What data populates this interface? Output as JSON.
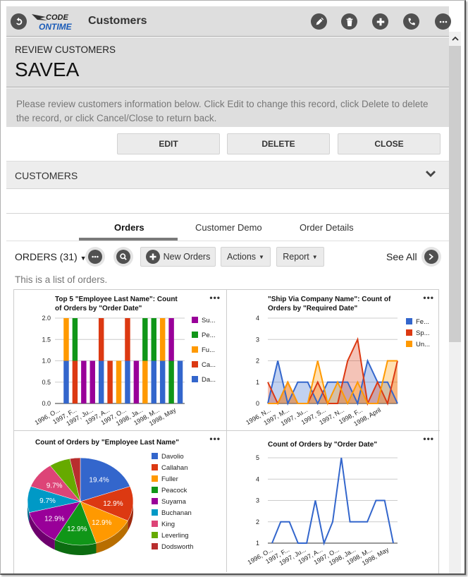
{
  "appbar": {
    "title": "Customers",
    "logo_line1": "CODE",
    "logo_line2": "ONTIME",
    "icons": [
      "back-icon",
      "pencil-icon",
      "trash-icon",
      "plus-icon",
      "phone-icon",
      "more-icon"
    ]
  },
  "review": {
    "subtitle": "REVIEW CUSTOMERS",
    "record": "SAVEA",
    "description": "Please review customers information below. Click Edit to change this record, click Delete to delete the record, or click Cancel/Close to return back."
  },
  "actions": {
    "edit": "EDIT",
    "delete": "DELETE",
    "close": "CLOSE"
  },
  "section": {
    "label": "CUSTOMERS"
  },
  "tabs": [
    {
      "label": "Orders",
      "active": true
    },
    {
      "label": "Customer Demo",
      "active": false
    },
    {
      "label": "Order Details",
      "active": false
    }
  ],
  "orders_toolbar": {
    "label": "ORDERS (31)",
    "new_button": "New Orders",
    "actions_button": "Actions",
    "report_button": "Report",
    "see_all": "See All",
    "description": "This is a list of orders."
  },
  "more_label": "•••",
  "colors": {
    "blue": "#3366cc",
    "red": "#dc3912",
    "orange": "#ff9900",
    "green": "#109618",
    "purple": "#990099",
    "teal": "#0099c6",
    "pink": "#dd4477",
    "lime": "#66aa00",
    "darkred": "#b82e2e"
  },
  "chart_data": [
    {
      "type": "bar",
      "stacked": true,
      "title_lines": [
        "Top 5 \"Employee Last Name\": Count",
        "of Orders by \"Order Date\""
      ],
      "xlabel": "",
      "ylabel": "",
      "ylim": [
        0,
        2
      ],
      "yticks": [
        "0.0",
        "0.5",
        "1.0",
        "1.5",
        "2.0"
      ],
      "xtick_labels": [
        "1996, O...",
        "1997, F...",
        "1997, Ju...",
        "1997, A...",
        "1997, O...",
        "1998, Ja...",
        "1998, M...",
        "1998, May"
      ],
      "legend_position": "right",
      "series": [
        {
          "name": "Da...",
          "color": "#3366cc",
          "values": [
            1,
            0,
            0,
            0,
            1,
            0,
            0,
            1,
            0,
            0,
            1,
            1,
            0,
            1
          ]
        },
        {
          "name": "Ca...",
          "color": "#dc3912",
          "values": [
            0,
            1,
            0,
            0,
            1,
            1,
            0,
            1,
            0,
            0,
            0,
            0,
            0,
            0
          ]
        },
        {
          "name": "Fu...",
          "color": "#ff9900",
          "values": [
            1,
            0,
            0,
            0,
            0,
            0,
            1,
            0,
            0,
            1,
            0,
            1,
            0,
            0
          ]
        },
        {
          "name": "Pe...",
          "color": "#109618",
          "values": [
            0,
            1,
            0,
            0,
            0,
            0,
            0,
            0,
            0,
            1,
            1,
            0,
            1,
            0
          ]
        },
        {
          "name": "Su...",
          "color": "#990099",
          "values": [
            0,
            0,
            1,
            1,
            0,
            0,
            0,
            0,
            1,
            0,
            0,
            0,
            1,
            0
          ]
        }
      ],
      "legend_order": [
        "Su...",
        "Pe...",
        "Fu...",
        "Ca...",
        "Da..."
      ]
    },
    {
      "type": "area",
      "title_lines": [
        "\"Ship Via Company Name\": Count of",
        "Orders by \"Required Date\""
      ],
      "ylim": [
        0,
        4
      ],
      "yticks": [
        "0",
        "1",
        "2",
        "3",
        "4"
      ],
      "xtick_labels": [
        "1996, N...",
        "1997, M...",
        "1997, Ju...",
        "1997, S...",
        "1997, N...",
        "1998, F...",
        "1998, April"
      ],
      "legend_position": "right",
      "series": [
        {
          "name": "Fe...",
          "color": "#3366cc",
          "values": [
            0,
            2,
            0,
            1,
            1,
            0,
            1,
            1,
            1,
            0,
            2,
            1,
            1,
            0
          ]
        },
        {
          "name": "Sp...",
          "color": "#dc3912",
          "values": [
            1,
            0,
            1,
            0,
            0,
            1,
            0,
            0,
            2,
            3,
            0,
            1,
            0,
            2
          ]
        },
        {
          "name": "Un...",
          "color": "#ff9900",
          "values": [
            0,
            0,
            1,
            0,
            0,
            2,
            0,
            1,
            0,
            1,
            0,
            0,
            2,
            2
          ]
        }
      ]
    },
    {
      "type": "pie",
      "title": "Count of Orders by \"Employee Last Name\"",
      "legend_position": "right",
      "slices": [
        {
          "label": "Davolio",
          "percent": 19.4,
          "color": "#3366cc"
        },
        {
          "label": "Callahan",
          "percent": 12.9,
          "color": "#dc3912"
        },
        {
          "label": "Fuller",
          "percent": 12.9,
          "color": "#ff9900"
        },
        {
          "label": "Peacock",
          "percent": 12.9,
          "color": "#109618"
        },
        {
          "label": "Suyama",
          "percent": 12.9,
          "color": "#990099"
        },
        {
          "label": "Buchanan",
          "percent": 9.7,
          "color": "#0099c6"
        },
        {
          "label": "King",
          "percent": 9.7,
          "color": "#dd4477"
        },
        {
          "label": "Leverling",
          "percent": 6.5,
          "color": "#66aa00"
        },
        {
          "label": "Dodsworth",
          "percent": 3.2,
          "color": "#b82e2e"
        }
      ],
      "slice_labels_shown": [
        "19.4%",
        "12.9%",
        "12.9%",
        "12.9%",
        "12.9%",
        "9.7%"
      ]
    },
    {
      "type": "line",
      "title": "Count of Orders by \"Order Date\"",
      "ylim": [
        1,
        5
      ],
      "yticks": [
        "1",
        "2",
        "3",
        "4",
        "5"
      ],
      "xtick_labels": [
        "1996, O...",
        "1997, F...",
        "1997, Ju...",
        "1997, A...",
        "1997, O...",
        "1998, Ja...",
        "1998, M...",
        "1998, May"
      ],
      "series": [
        {
          "name": "Count",
          "color": "#3366cc",
          "values": [
            1,
            2,
            2,
            1,
            1,
            3,
            1,
            2,
            5,
            2,
            2,
            2,
            3,
            3,
            1
          ]
        }
      ]
    }
  ]
}
